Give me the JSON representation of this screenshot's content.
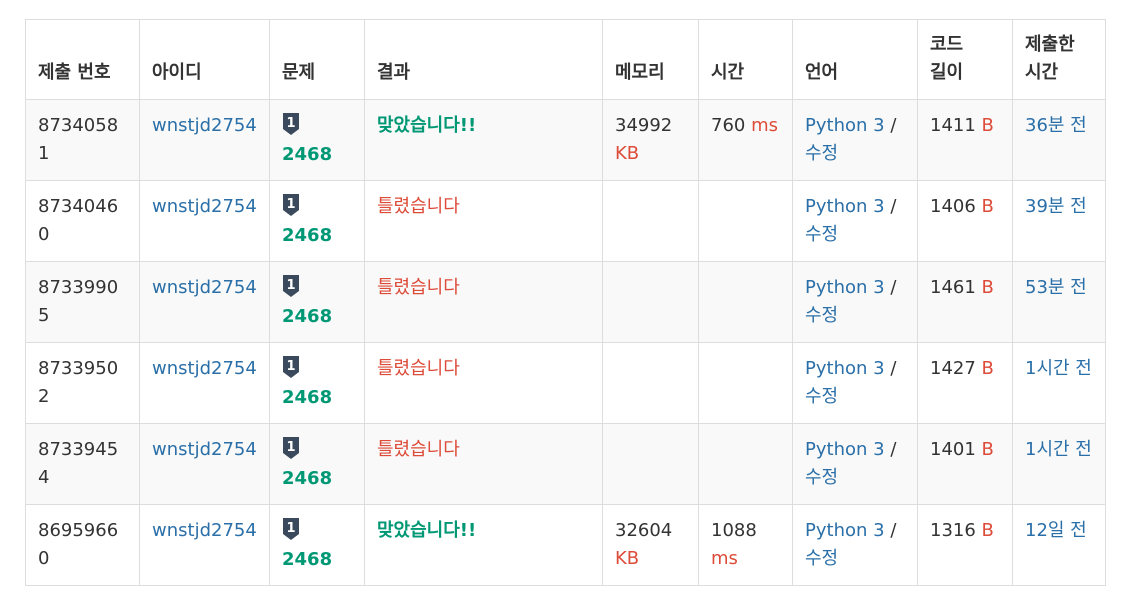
{
  "table": {
    "headers": {
      "submission_id": "제출 번호",
      "user_id": "아이디",
      "problem": "문제",
      "result": "결과",
      "memory": "메모리",
      "time": "시간",
      "language": "언어",
      "code_length": "코드 길이",
      "submitted_at": "제출한 시간"
    },
    "rows": [
      {
        "id": "87340581",
        "user": "wnstjd2754",
        "problem": "2468",
        "result": "맞았습니다!!",
        "result_type": "accepted",
        "memory": "34992",
        "memory_unit": "KB",
        "time": "760",
        "time_unit": "ms",
        "lang": "Python 3",
        "edit": "수정",
        "length": "1411",
        "length_unit": "B",
        "ago": "36분 전"
      },
      {
        "id": "87340460",
        "user": "wnstjd2754",
        "problem": "2468",
        "result": "틀렸습니다",
        "result_type": "wrong",
        "memory": "",
        "memory_unit": "",
        "time": "",
        "time_unit": "",
        "lang": "Python 3",
        "edit": "수정",
        "length": "1406",
        "length_unit": "B",
        "ago": "39분 전"
      },
      {
        "id": "87339905",
        "user": "wnstjd2754",
        "problem": "2468",
        "result": "틀렸습니다",
        "result_type": "wrong",
        "memory": "",
        "memory_unit": "",
        "time": "",
        "time_unit": "",
        "lang": "Python 3",
        "edit": "수정",
        "length": "1461",
        "length_unit": "B",
        "ago": "53분 전"
      },
      {
        "id": "87339502",
        "user": "wnstjd2754",
        "problem": "2468",
        "result": "틀렸습니다",
        "result_type": "wrong",
        "memory": "",
        "memory_unit": "",
        "time": "",
        "time_unit": "",
        "lang": "Python 3",
        "edit": "수정",
        "length": "1427",
        "length_unit": "B",
        "ago": "1시간 전"
      },
      {
        "id": "87339454",
        "user": "wnstjd2754",
        "problem": "2468",
        "result": "틀렸습니다",
        "result_type": "wrong",
        "memory": "",
        "memory_unit": "",
        "time": "",
        "time_unit": "",
        "lang": "Python 3",
        "edit": "수정",
        "length": "1401",
        "length_unit": "B",
        "ago": "1시간 전"
      },
      {
        "id": "86959660",
        "user": "wnstjd2754",
        "problem": "2468",
        "result": "맞았습니다!!",
        "result_type": "accepted",
        "memory": "32604",
        "memory_unit": "KB",
        "time": "1088",
        "time_unit": "ms",
        "lang": "Python 3",
        "edit": "수정",
        "length": "1316",
        "length_unit": "B",
        "ago": "12일 전"
      }
    ]
  },
  "tier_badge": {
    "icon": "bronze-tier-1-icon",
    "label": "1",
    "color": "#3a4a5c"
  },
  "colors": {
    "link": "#2a6fa8",
    "accepted": "#009874",
    "wrong": "#dd4b39",
    "border": "#dddddd",
    "stripe": "#f9f9f9"
  }
}
